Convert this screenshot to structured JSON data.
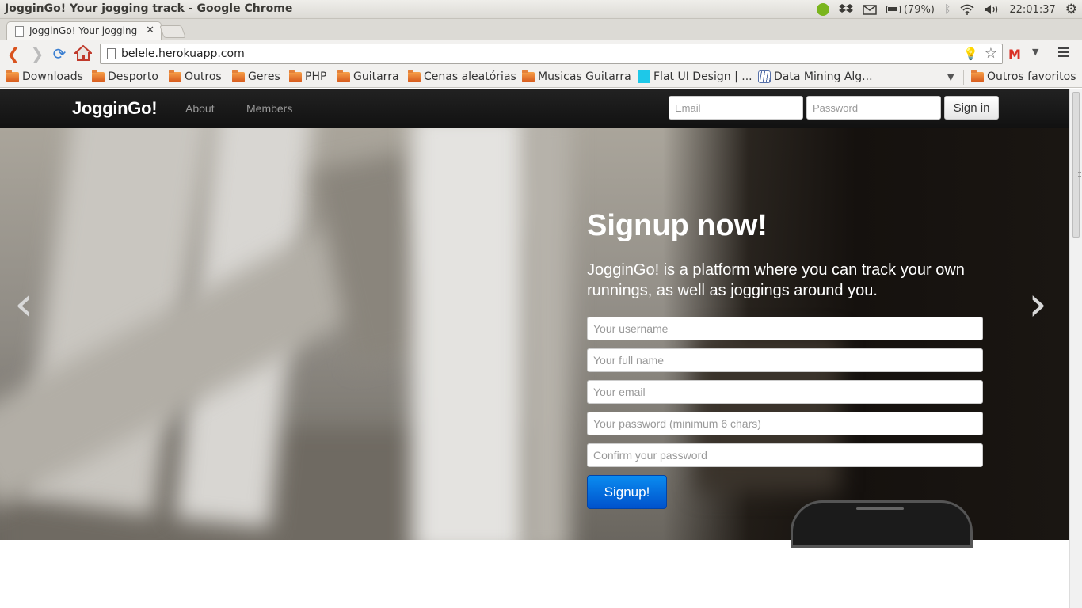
{
  "os": {
    "window_title": "JogginGo! Your jogging track - Google Chrome",
    "battery": "(79%)",
    "clock": "22:01:37",
    "tray_icons": [
      "spotify-icon",
      "dropbox-icon",
      "mail-icon",
      "battery-icon",
      "bluetooth-icon",
      "wifi-icon",
      "volume-icon",
      "settings-gear-icon"
    ]
  },
  "browser": {
    "tab_title": "JogginGo! Your jogging tr",
    "url": "belele.herokuapp.com",
    "bookmarks": [
      {
        "label": "Downloads",
        "icon": "folder-icon"
      },
      {
        "label": "Desporto",
        "icon": "folder-icon"
      },
      {
        "label": "Outros",
        "icon": "folder-icon"
      },
      {
        "label": "Geres",
        "icon": "folder-icon"
      },
      {
        "label": "PHP",
        "icon": "folder-icon"
      },
      {
        "label": "Guitarra",
        "icon": "folder-icon"
      },
      {
        "label": "Cenas aleatórias",
        "icon": "folder-icon"
      },
      {
        "label": "Musicas Guitarra",
        "icon": "folder-icon"
      },
      {
        "label": "Flat UI Design | ...",
        "icon": "flat-ui-icon"
      },
      {
        "label": "Data Mining Alg...",
        "icon": "data-mining-icon"
      }
    ],
    "other_bookmarks": "Outros favoritos"
  },
  "site": {
    "brand": "JogginGo!",
    "nav": {
      "about": "About",
      "members": "Members"
    },
    "signin": {
      "email_placeholder": "Email",
      "password_placeholder": "Password",
      "button": "Sign in"
    },
    "hero": {
      "title": "Signup now!",
      "description": "JogginGo! is a platform where you can track your own runnings, as well as joggings around you.",
      "fields": {
        "username": "Your username",
        "full_name": "Your full name",
        "email": "Your email",
        "password": "Your password (minimum 6 chars)",
        "confirm": "Confirm your password"
      },
      "submit": "Signup!",
      "prev_arrow": "‹",
      "next_arrow": "›"
    }
  }
}
